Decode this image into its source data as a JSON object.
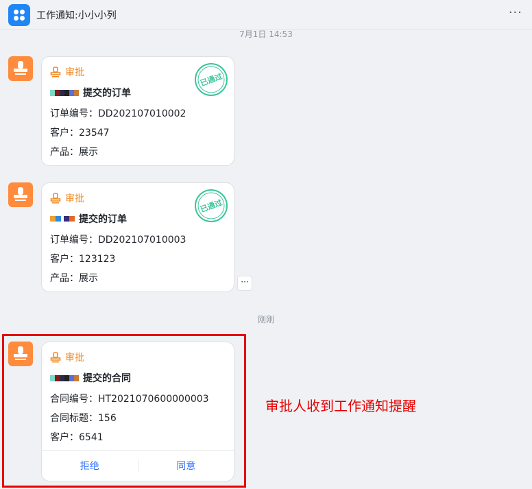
{
  "header": {
    "title": "工作通知:小小小列",
    "more": "···"
  },
  "timestamps": [
    "7月1日 14:53",
    "刚刚"
  ],
  "messages": [
    {
      "label": "审批",
      "title": "提交的订单",
      "fields": [
        "订单编号：DD202107010002",
        "客户：23547",
        "产品：展示"
      ],
      "stamp": "已通过"
    },
    {
      "label": "审批",
      "title": "提交的订单",
      "fields": [
        "订单编号：DD202107010003",
        "客户：123123",
        "产品：展示"
      ],
      "stamp": "已通过"
    },
    {
      "label": "审批",
      "title": "提交的合同",
      "fields": [
        "合同编号：HT2021070600000003",
        "合同标题：156",
        "客户：6541"
      ],
      "actions": [
        "拒绝",
        "同意"
      ]
    }
  ],
  "message_more": "···",
  "annotation": "审批人收到工作通知提醒",
  "colors": {
    "accent": "#1f87f5",
    "approval_orange": "#ff8b3d",
    "stamp_green": "#3cc49a",
    "action_blue": "#3370ff",
    "highlight_red": "#e50000"
  }
}
